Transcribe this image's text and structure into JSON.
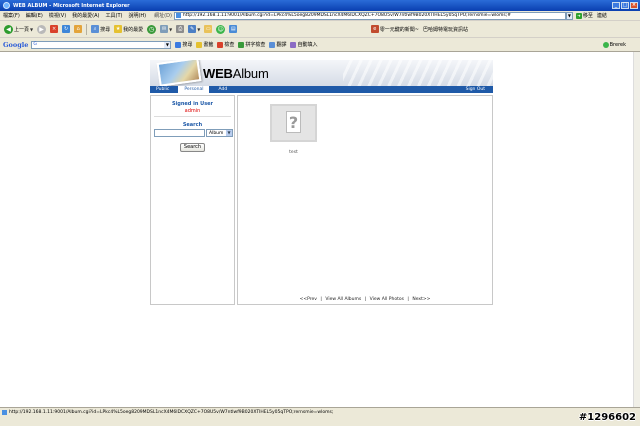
{
  "window": {
    "title": "WEB ALBUM - Microsoft Internet Explorer",
    "buttons": [
      "_",
      "□",
      "×"
    ]
  },
  "menubar": {
    "items": [
      "檔案(F)",
      "編輯(E)",
      "檢視(V)",
      "我的最愛(A)",
      "工具(T)",
      "說明(H)"
    ],
    "address_label": "網址(D)",
    "address_value": "http://192.168.1.11:9001/Album.cgi?id=LPkc4%L5oeg8209MDSL1ncX4M6lDCXQZC+7O8U5v/W7ntlwf9B020XTIHEL5y05qTPO;rernsmie=wloms;#",
    "go_label": "移至",
    "links_label": "連結"
  },
  "toolbar": {
    "back_label": "上一頁",
    "search_label": "搜尋",
    "favorites_label": "我的最愛",
    "links_item_1": "零一元鍵的新聞~",
    "links_item_2": "巴哈姆特電玩資訊站"
  },
  "googlebar": {
    "logo": "Google",
    "search_icon_label": "G",
    "items": [
      "搜尋",
      "書籤",
      "檢查",
      "拼字檢查",
      "翻譯",
      "自動填入"
    ],
    "right_label": "Brerek"
  },
  "album": {
    "title_bold": "WEB",
    "title_thin": "Album",
    "nav": {
      "public": "Public",
      "personal": "Personal",
      "add": "Add",
      "signout": "Sign Out"
    },
    "sidebar": {
      "signed_in_label": "Signed in User",
      "user": "admin",
      "search_title": "Search",
      "search_value": "",
      "select_value": "Album",
      "search_button": "Search"
    },
    "photos": [
      {
        "caption": "test",
        "icon": "question-mark"
      }
    ],
    "pager": {
      "prev": "<<Prev",
      "view_all_albums": "View All Albums",
      "view_all_photos": "View All Photos",
      "next": "Next>>",
      "separator": "|"
    }
  },
  "statusbar": {
    "url": "http://192.168.1.11:9001/Album.cgi?id=LPkc4%L5oeg8209MDSL1ncX4M6lDCXQZC+7O8U5v/W7ntlwf9B020XTIHEL5y05qTPO;rernsmie=wloms;"
  },
  "watermark": "#1296602"
}
